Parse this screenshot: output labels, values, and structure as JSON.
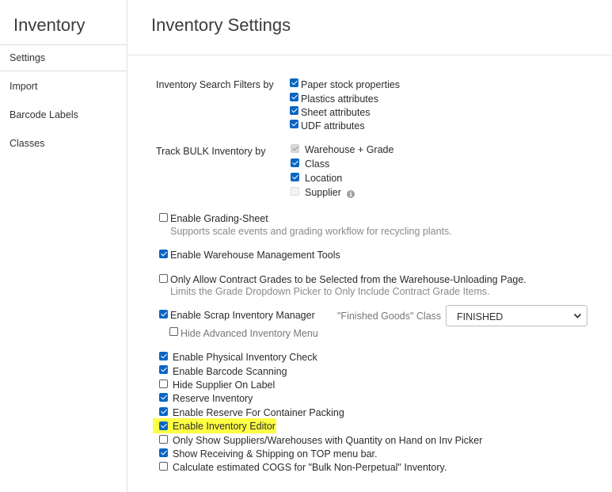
{
  "sidebar": {
    "title": "Inventory",
    "items": [
      {
        "label": "Settings"
      },
      {
        "label": "Import"
      },
      {
        "label": "Barcode Labels"
      },
      {
        "label": "Classes"
      }
    ]
  },
  "main": {
    "title": "Inventory Settings",
    "search_filters": {
      "label": "Inventory Search Filters by",
      "options": [
        {
          "label": "Paper stock properties",
          "checked": true
        },
        {
          "label": "Plastics attributes",
          "checked": true
        },
        {
          "label": "Sheet attributes",
          "checked": true
        },
        {
          "label": "UDF attributes",
          "checked": true
        }
      ]
    },
    "bulk_tracking": {
      "label": "Track BULK Inventory by",
      "options": [
        {
          "label": "Warehouse + Grade",
          "checked": true,
          "disabled": true
        },
        {
          "label": "Class",
          "checked": true
        },
        {
          "label": "Location",
          "checked": true
        },
        {
          "label": "Supplier",
          "checked": false,
          "disabled": true
        }
      ]
    },
    "grading_sheet": {
      "label": "Enable Grading-Sheet",
      "checked": false,
      "description": "Supports scale events and grading workflow for recycling plants."
    },
    "warehouse_tools": {
      "label": "Enable Warehouse Management Tools",
      "checked": true
    },
    "contract_grades": {
      "label": "Only Allow Contract Grades to be Selected from the Warehouse-Unloading Page.",
      "checked": false,
      "description": "Limits the Grade Dropdown Picker to Only Include Contract Grade Items."
    },
    "scrap_manager": {
      "label": "Enable Scrap Inventory Manager",
      "checked": true,
      "hide_menu_label": "Hide Advanced Inventory Menu",
      "hide_menu_checked": false,
      "finished_goods_label": "\"Finished Goods\" Class",
      "finished_goods_value": "FINISHED"
    },
    "options": [
      {
        "label": "Enable Physical Inventory Check",
        "checked": true
      },
      {
        "label": "Enable Barcode Scanning",
        "checked": true
      },
      {
        "label": "Hide Supplier On Label",
        "checked": false
      },
      {
        "label": "Reserve Inventory",
        "checked": true
      },
      {
        "label": "Enable Reserve For Container Packing",
        "checked": true
      },
      {
        "label": "Enable Inventory Editor",
        "checked": true,
        "highlighted": true
      },
      {
        "label": "Only Show Suppliers/Warehouses with Quantity on Hand on Inv Picker",
        "checked": false
      },
      {
        "label": "Show Receiving & Shipping on TOP menu bar.",
        "checked": true
      },
      {
        "label": "Calculate estimated COGS for \"Bulk Non-Perpetual\" Inventory.",
        "checked": false
      }
    ]
  },
  "colors": {
    "accent": "#0a66c2",
    "highlight": "#ffff44"
  }
}
